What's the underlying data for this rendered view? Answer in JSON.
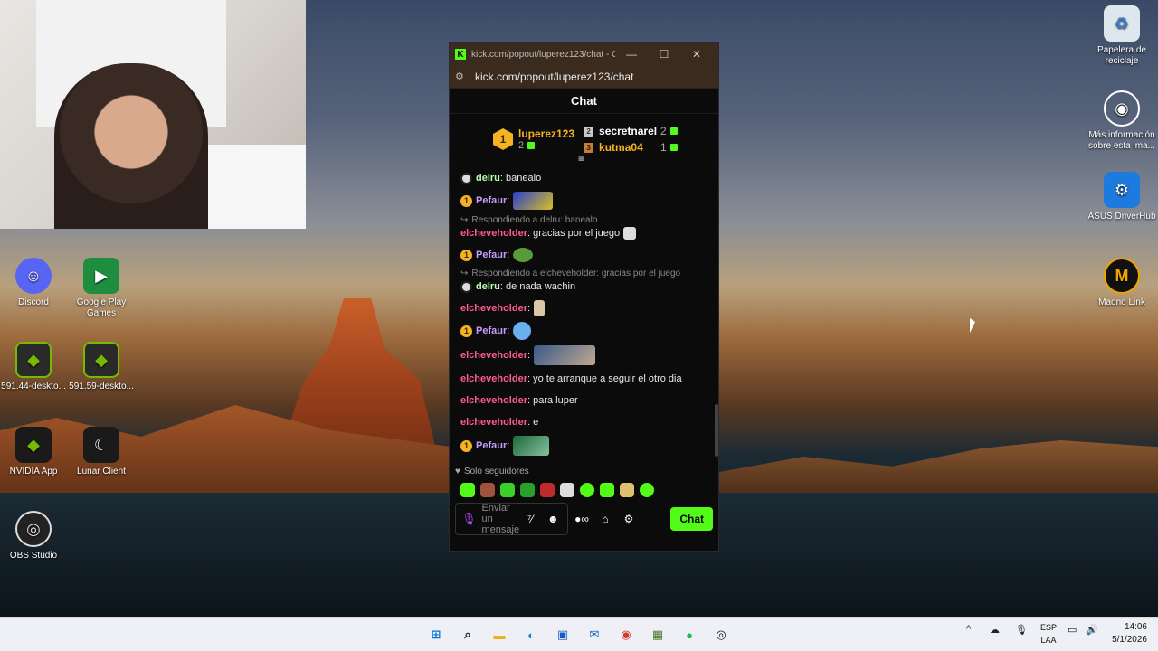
{
  "webcam": {},
  "desktop_icons": [
    {
      "label": "Discord"
    },
    {
      "label": "Google Play Games"
    },
    {
      "label": "591.44-deskto..."
    },
    {
      "label": "591.59-deskto..."
    },
    {
      "label": "NVIDIA App"
    },
    {
      "label": "Lunar Client"
    },
    {
      "label": "OBS Studio"
    },
    {
      "label": "Papelera de reciclaje"
    },
    {
      "label": "Más información sobre esta ima..."
    },
    {
      "label": "ASUS DriverHub"
    },
    {
      "label": "Maono Link"
    }
  ],
  "window": {
    "title": "kick.com/popout/luperez123/chat - G...",
    "url": "kick.com/popout/luperez123/chat",
    "chat_title": "Chat"
  },
  "leaderboard": {
    "first": {
      "rank": "1",
      "name": "luperez123",
      "count": "2"
    },
    "second": {
      "name": "secretnarel",
      "count": "2"
    },
    "third": {
      "name": "kutma04",
      "count": "1"
    }
  },
  "messages": [
    {
      "user": "delru",
      "text": "banealo"
    },
    {
      "user": "Pefaur",
      "text": ""
    },
    {
      "reply": "Respondiendo a delru: banealo",
      "user": "elcheveholder",
      "text": "gracias por el juego"
    },
    {
      "user": "Pefaur",
      "text": ""
    },
    {
      "reply": "Respondiendo a elcheveholder: gracias por el juego",
      "user": "delru",
      "text": "de nada wachin"
    },
    {
      "user": "elcheveholder",
      "text": ""
    },
    {
      "user": "Pefaur",
      "text": ""
    },
    {
      "user": "elcheveholder",
      "text": ""
    },
    {
      "user": "elcheveholder",
      "text": "yo te arranque a seguir el otro dia"
    },
    {
      "user": "elcheveholder",
      "text": "para luper"
    },
    {
      "user": "elcheveholder",
      "text": "e"
    },
    {
      "user": "Pefaur",
      "text": ""
    }
  ],
  "composer": {
    "followers_label": "Solo seguidores",
    "placeholder": "Enviar un mensaje",
    "send_label": "Chat"
  },
  "taskbar": {
    "lang_top": "ESP",
    "lang_bottom": "LAA",
    "time": "14:06",
    "date": "5/1/2026"
  },
  "colors": {
    "kick_green": "#53fc18",
    "gold": "#f5b323",
    "user_delru": "#b8ffb0",
    "user_pefaur": "#c79bff",
    "user_elche": "#ff5c8a"
  }
}
